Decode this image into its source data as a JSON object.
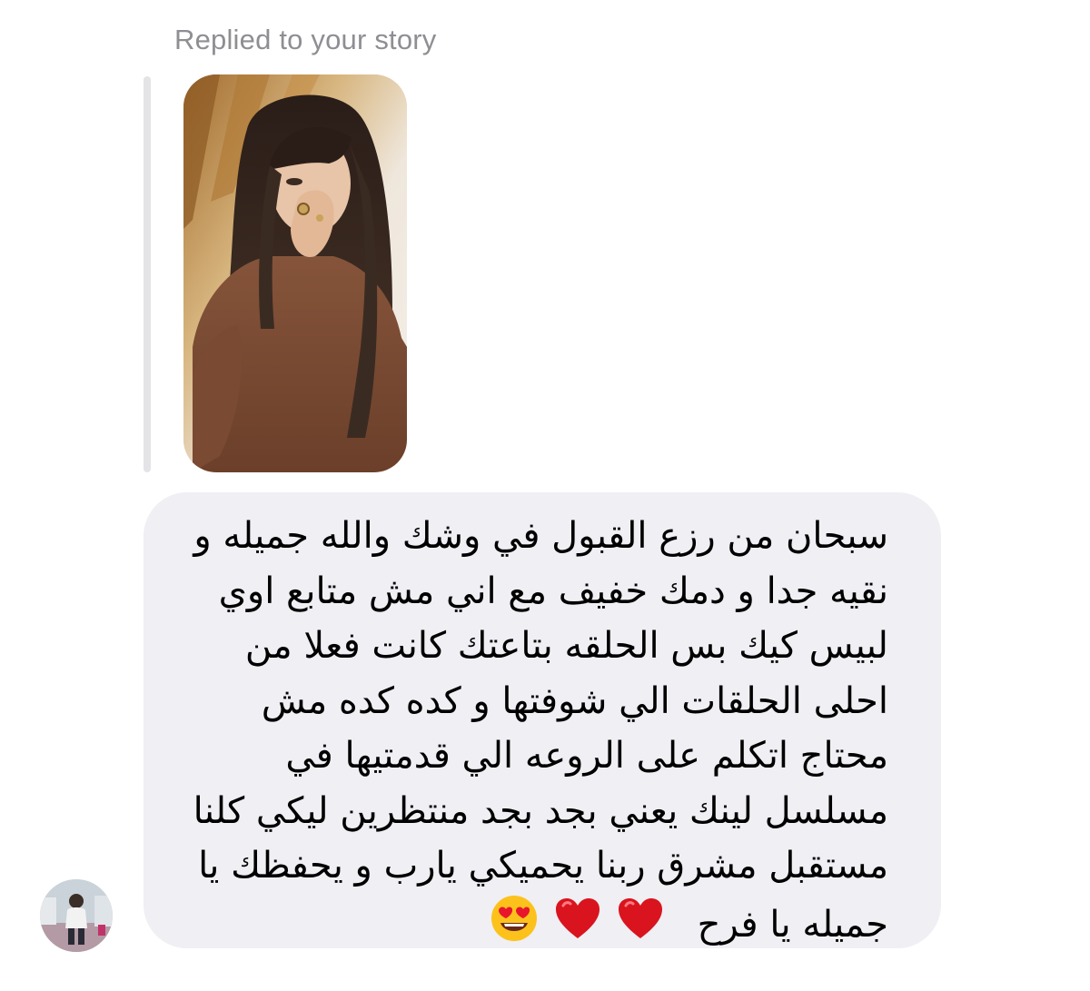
{
  "conversation": {
    "reply_label": "Replied to your story"
  },
  "story": {
    "icon": "story-photo-thumbnail",
    "description_colors": {
      "sweater": "#7a4a33",
      "hair": "#2b1f1a",
      "background": "#c9a97b"
    }
  },
  "message": {
    "bubble_color": "#efeff4",
    "lines": [
      "سبحان من رزع القبول في وشك والله جميله و",
      "نقيه جدا و دمك خفيف مع اني مش متابع اوي",
      "لبيس كيك بس الحلقه بتاعتك كانت فعلا من",
      "احلى الحلقات الي شوفتها و كده كده مش",
      "محتاج اتكلم على الروعه الي قدمتيها في",
      "مسلسل لينك يعني بجد بجد منتظرين ليكي كلنا",
      "مستقبل مشرق ربنا يحميكي يارب و يحفظك يا",
      "جميله يا فرح"
    ],
    "emojis": [
      "heart-icon",
      "heart-icon",
      "heart-eyes-icon"
    ]
  },
  "sender": {
    "icon": "avatar"
  }
}
